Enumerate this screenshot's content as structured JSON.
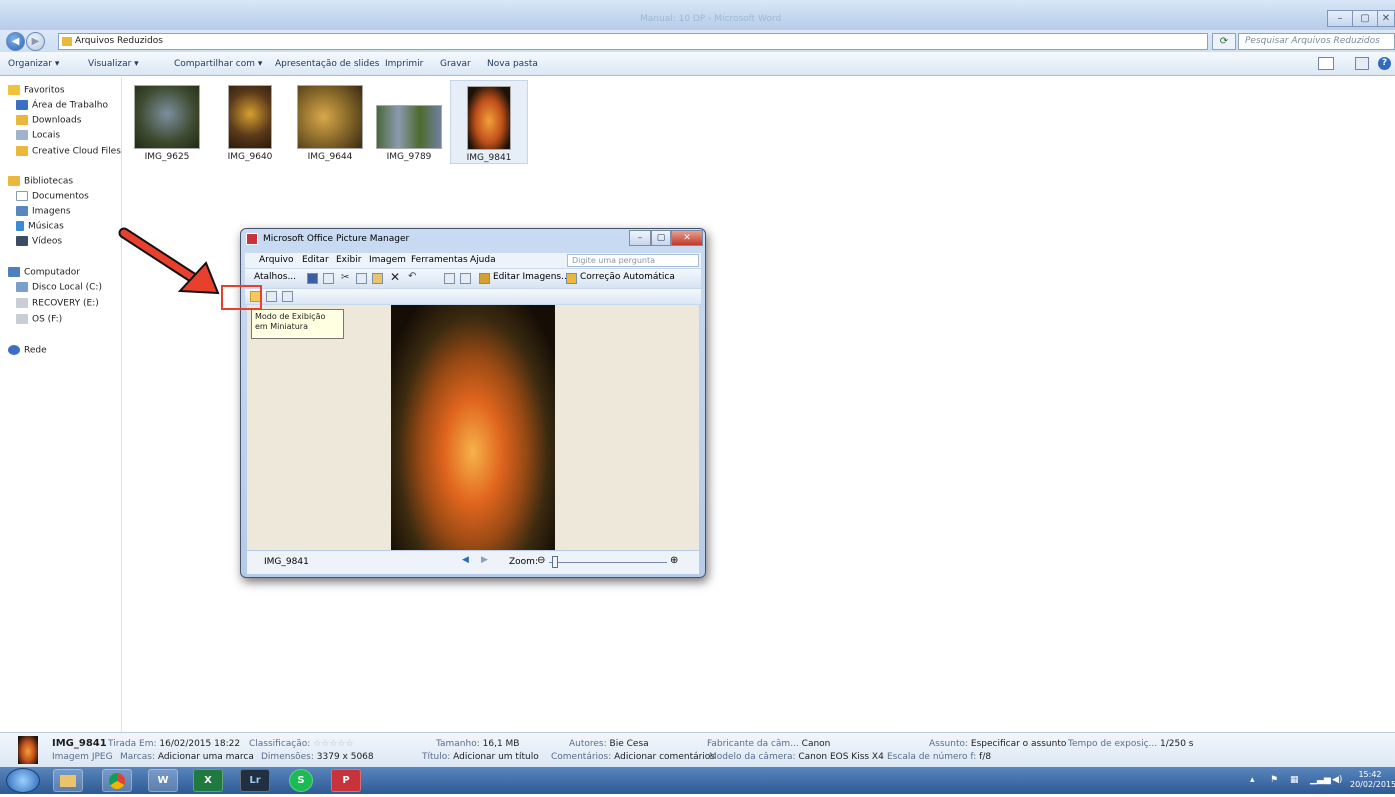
{
  "titlebar": {
    "title": "Manual: 10 DP - Microsoft Word",
    "min": "–",
    "max": "▢",
    "close": "✕"
  },
  "address": {
    "path": "Arquivos Reduzidos",
    "search_placeholder": "Pesquisar Arquivos Reduzidos"
  },
  "commands": [
    "Organizar ▾",
    "Visualizar ▾",
    "Compartilhar com ▾",
    "Apresentação de slides",
    "Imprimir",
    "Gravar",
    "Nova pasta"
  ],
  "sidebar": {
    "favorites": {
      "label": "Favoritos",
      "items": [
        "Área de Trabalho",
        "Downloads",
        "Locais",
        "Creative Cloud Files"
      ]
    },
    "libraries": {
      "label": "Bibliotecas",
      "items": [
        "Documentos",
        "Imagens",
        "Músicas",
        "Vídeos"
      ]
    },
    "computer": {
      "label": "Computador",
      "items": [
        "Disco Local (C:)",
        "RECOVERY (E:)",
        "OS (F:)"
      ]
    },
    "network": {
      "label": "Rede"
    }
  },
  "files": [
    {
      "name": "IMG_9625",
      "color": "#4a5a3a"
    },
    {
      "name": "IMG_9640",
      "color": "#5b3a1a"
    },
    {
      "name": "IMG_9644",
      "color": "#8a6a2a"
    },
    {
      "name": "IMG_9789",
      "color": "#6a7a8a"
    },
    {
      "name": "IMG_9841",
      "color": "#c0501a"
    }
  ],
  "picture_manager": {
    "title": "Microsoft Office Picture Manager",
    "menu": [
      "Arquivo",
      "Editar",
      "Exibir",
      "Imagem",
      "Ferramentas",
      "Ajuda"
    ],
    "question_placeholder": "Digite uma pergunta",
    "toolbar": {
      "shortcuts": "Atalhos...",
      "edit_images": "Editar Imagens...",
      "auto_correct": "Correção Automática"
    },
    "tooltip": "Modo de Exibição em Miniatura",
    "status": {
      "filename": "IMG_9841",
      "zoom_label": "Zoom:"
    }
  },
  "details": {
    "filename": "IMG_9841",
    "filetype": "Imagem JPEG",
    "fields": [
      {
        "k": "Tirada Em:",
        "v": "16/02/2015 18:22"
      },
      {
        "k": "Marcas:",
        "v": "Adicionar uma marca"
      },
      {
        "k": "Classificação:",
        "v": "☆☆☆☆☆"
      },
      {
        "k": "Dimensões:",
        "v": "3379 x 5068"
      },
      {
        "k": "Tamanho:",
        "v": "16,1 MB"
      },
      {
        "k": "Título:",
        "v": "Adicionar um título"
      },
      {
        "k": "Autores:",
        "v": "Bie Cesa"
      },
      {
        "k": "Comentários:",
        "v": "Adicionar comentários"
      },
      {
        "k": "Fabricante da câm...",
        "v": "Canon"
      },
      {
        "k": "Modelo da câmera:",
        "v": "Canon EOS Kiss X4"
      },
      {
        "k": "Assunto:",
        "v": "Especificar o assunto"
      },
      {
        "k": "Escala de número f:",
        "v": "f/8"
      },
      {
        "k": "Tempo de exposiç...",
        "v": "1/250 s"
      }
    ]
  },
  "taskbar": {
    "apps": [
      "W",
      "X",
      "Lr",
      "S",
      "P"
    ],
    "time": "15:42",
    "date": "20/02/2015"
  },
  "colors": {
    "accent": "#e8402c",
    "taskbar": "#2e5a95"
  }
}
